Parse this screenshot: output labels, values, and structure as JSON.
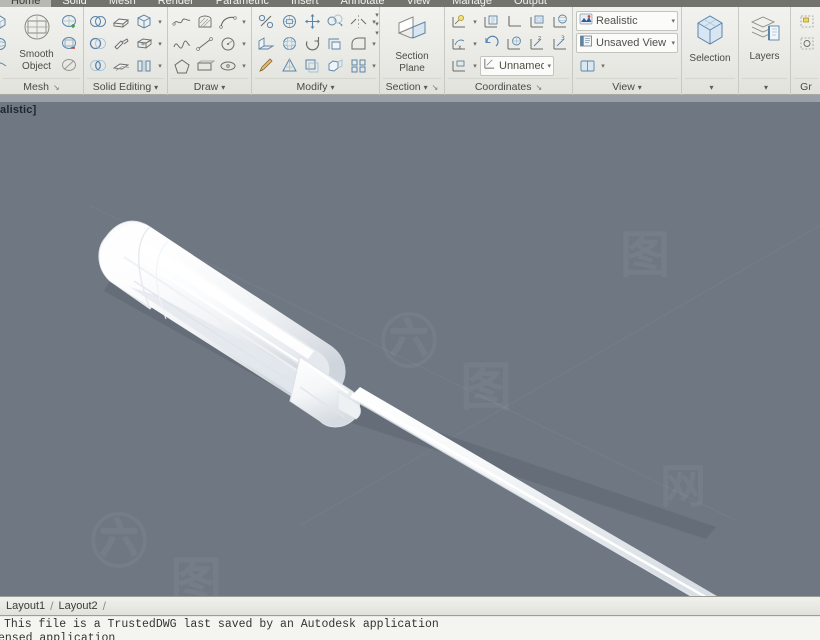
{
  "app": {
    "ribbon_tabs": [
      {
        "label": "Home",
        "active": true
      },
      {
        "label": "Solid",
        "active": false
      },
      {
        "label": "Mesh",
        "active": false
      },
      {
        "label": "Render",
        "active": false
      },
      {
        "label": "Parametric",
        "active": false
      },
      {
        "label": "Insert",
        "active": false
      },
      {
        "label": "Annotate",
        "active": false
      },
      {
        "label": "View",
        "active": false
      },
      {
        "label": "Manage",
        "active": false
      },
      {
        "label": "Output",
        "active": false
      }
    ]
  },
  "panels": {
    "mesh": {
      "title": "Mesh",
      "dialog_launcher": "↘",
      "big_button": {
        "label_line1": "Smooth",
        "label_line2": "Object",
        "icon": "smooth-object-icon"
      },
      "small_buttons": [
        {
          "name": "refine-mesh-icon"
        },
        {
          "name": "add-crease-icon"
        },
        {
          "name": "remove-crease-icon"
        }
      ]
    },
    "solid_editing": {
      "title": "Solid Editing",
      "caret": "▾",
      "buttons": [
        {
          "name": "union-icon"
        },
        {
          "name": "extrude-face-icon"
        },
        {
          "name": "solid-box-icon",
          "has_drop": true
        },
        {
          "name": "subtract-icon"
        },
        {
          "name": "taper-face-icon"
        },
        {
          "name": "imprint-icon",
          "has_drop": true
        },
        {
          "name": "intersect-icon"
        },
        {
          "name": "offset-face-icon"
        },
        {
          "name": "separate-icon",
          "has_drop": true
        }
      ]
    },
    "draw": {
      "title": "Draw",
      "caret": "▾",
      "buttons": [
        {
          "name": "polyline-icon"
        },
        {
          "name": "hatch-icon"
        },
        {
          "name": "arc-icon",
          "has_drop": true
        },
        {
          "name": "spline-icon"
        },
        {
          "name": "line-icon"
        },
        {
          "name": "circle-icon",
          "has_drop": true
        },
        {
          "name": "polygon-icon"
        },
        {
          "name": "rectangle-icon"
        },
        {
          "name": "ellipse-icon",
          "has_drop": true
        }
      ]
    },
    "modify": {
      "title": "Modify",
      "caret": "▾",
      "buttons": [
        {
          "name": "trim-icon"
        },
        {
          "name": "3d-align-icon"
        },
        {
          "name": "3d-move-icon"
        },
        {
          "name": "copy-icon"
        },
        {
          "name": "mirror-icon",
          "has_drop": true
        },
        {
          "name": "extrude-icon"
        },
        {
          "name": "3d-rotate-icon"
        },
        {
          "name": "rotate-icon"
        },
        {
          "name": "scale-icon"
        },
        {
          "name": "fillet-icon",
          "has_drop": true
        },
        {
          "name": "match-properties-icon"
        },
        {
          "name": "3d-scale-icon"
        },
        {
          "name": "offset-icon"
        },
        {
          "name": "3d-array-icon"
        },
        {
          "name": "array-icon",
          "has_drop": true
        }
      ]
    },
    "section": {
      "title": "Section",
      "caret": "▾",
      "dialog_launcher": "↘",
      "big_button": {
        "label_line1": "Section",
        "label_line2": "Plane",
        "icon": "section-plane-icon"
      },
      "left_drops": [
        {
          "name": "slice-drop-icon"
        },
        {
          "name": "flatshot-drop-icon"
        },
        {
          "name": "live-section-drop-icon"
        }
      ]
    },
    "coordinates": {
      "title": "Coordinates",
      "dialog_launcher": "↘",
      "buttons": [
        {
          "name": "ucs-icon",
          "has_drop": true
        },
        {
          "name": "ucs-face-icon"
        },
        {
          "name": "ucs-origin-icon"
        },
        {
          "name": "ucs-object-icon"
        },
        {
          "name": "ucs-view-icon"
        },
        {
          "name": "ucs-x-icon",
          "has_drop": true
        },
        {
          "name": "ucs-previous-icon"
        },
        {
          "name": "ucs-world-icon"
        },
        {
          "name": "ucs-z-axis-icon"
        },
        {
          "name": "ucs-3point-icon"
        },
        {
          "name": "ucs-named-icon",
          "has_drop": true
        }
      ],
      "named_ucs": {
        "label": "Unnamed",
        "caret": "▾",
        "icon": "ucs-manager-icon"
      }
    },
    "view": {
      "title": "View",
      "caret": "▾",
      "visual_style": {
        "label": "Realistic",
        "caret": "▾",
        "icon": "visual-style-icon"
      },
      "view_preset": {
        "label": "Unsaved View",
        "caret": "▾",
        "icon": "saved-view-icon"
      },
      "viewport_config": {
        "caret": "▾",
        "icon": "viewport-config-icon"
      }
    },
    "selection": {
      "title": "",
      "caret": "▾",
      "label": "Selection",
      "icon": "selection-cube-icon"
    },
    "layers": {
      "title": "",
      "caret": "▾",
      "label": "Layers",
      "icon": "layers-icon"
    },
    "groups": {
      "title": "",
      "label": "Gr",
      "icon": "group-icon"
    }
  },
  "viewport": {
    "label": "alistic]",
    "background_color": "#6e7782",
    "top_strip_color": "#9aa0a8",
    "model": {
      "name": "screwdriver-3d-model",
      "handle_color": "#f7f8f8",
      "blade_color": "#eef0f1"
    },
    "watermark": "六图网"
  },
  "layout_tabs": {
    "tabs": [
      {
        "label": "Layout1"
      },
      {
        "label": "Layout2"
      }
    ],
    "separator": "/"
  },
  "command_line": {
    "line1": "This file is a TrustedDWG last saved by an Autodesk application",
    "line2": "ensed application"
  },
  "colors": {
    "ribbon_bg": "#eaeae6",
    "tabstrip_bg": "#73736e",
    "icon_blue": "#5b84a8",
    "icon_gray": "#6c6c66",
    "text": "#4b4b46"
  }
}
